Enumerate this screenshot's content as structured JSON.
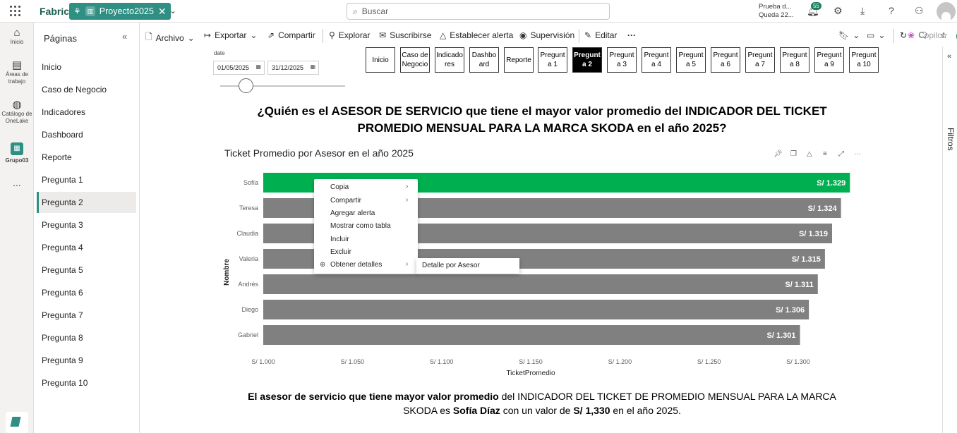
{
  "topbar": {
    "brand": "Fabric",
    "workspace": "Proyecto2025",
    "search_placeholder": "Buscar",
    "trial_line1": "Prueba d...",
    "trial_line2": "Queda 22...",
    "notification_count": "55",
    "icons": [
      "waffle-icon",
      "report-icon",
      "close-icon",
      "chevron-down-icon",
      "search-icon",
      "bell-icon",
      "gear-icon",
      "download-icon",
      "help-icon",
      "share-people-icon",
      "avatar"
    ]
  },
  "rail": {
    "items": [
      {
        "label": "Inicio",
        "icon": "home-icon"
      },
      {
        "label": "Áreas de trabajo",
        "icon": "workspaces-icon"
      },
      {
        "label": "Catálogo de OneLake",
        "icon": "onelake-icon"
      },
      {
        "label": "Grupo03",
        "icon": "group-icon"
      }
    ],
    "more": "..."
  },
  "pages": {
    "title": "Páginas",
    "items": [
      "Inicio",
      "Caso de Negocio",
      "Indicadores",
      "Dashboard",
      "Reporte",
      "Pregunta 1",
      "Pregunta 2",
      "Pregunta 3",
      "Pregunta 4",
      "Pregunta 5",
      "Pregunta 6",
      "Pregunta 7",
      "Pregunta 8",
      "Pregunta 9",
      "Pregunta 10"
    ],
    "active": "Pregunta 2"
  },
  "toolbar": {
    "archivo": "Archivo",
    "exportar": "Exportar",
    "compartir": "Compartir",
    "explorar": "Explorar",
    "suscribirse": "Suscribirse",
    "alerta": "Establecer alerta",
    "supervision": "Supervisión",
    "editar": "Editar",
    "more": "···",
    "copilot": "Copilot"
  },
  "filters": {
    "label": "Filtros"
  },
  "report": {
    "date_label": "date",
    "date_from": "01/05/2025",
    "date_to": "31/12/2025",
    "nav": [
      "Inicio",
      "Caso de Negocio",
      "Indicadores",
      "Dashboard",
      "Reporte",
      "Pregunta 1",
      "Pregunta 2",
      "Pregunta 3",
      "Pregunta 4",
      "Pregunta 5",
      "Pregunta 6",
      "Pregunta 7",
      "Pregunta 8",
      "Pregunta 9",
      "Pregunta 10"
    ],
    "nav_active": "Pregunta 2",
    "question": "¿Quién es el ASESOR DE SERVICIO que  tiene el mayor valor promedio del INDICADOR DEL TICKET PROMEDIO MENSUAL PARA LA MARCA SKODA  en el año 2025?",
    "answer_bold1": "El asesor de servicio que tiene mayor valor promedio",
    "answer_text1": " del INDICADOR DEL TICKET DE PROMEDIO MENSUAL PARA LA MARCA SKODA es ",
    "answer_bold2": "Sofía Díaz",
    "answer_text2": " con un valor de ",
    "answer_bold3": "S/ 1,330",
    "answer_text3": " en el año 2025."
  },
  "chart_data": {
    "type": "bar",
    "orientation": "horizontal",
    "title": "Ticket Promedio por Asesor en el año 2025",
    "xlabel": "TicketPromedio",
    "ylabel": "Nombre",
    "categories": [
      "Sofía",
      "Teresa",
      "Claudia",
      "Valeria",
      "Andrés",
      "Diego",
      "Gabriel"
    ],
    "values": [
      1329,
      1324,
      1319,
      1315,
      1311,
      1306,
      1301
    ],
    "data_labels": [
      "S/ 1.329",
      "S/ 1.324",
      "S/ 1.319",
      "S/ 1.315",
      "S/ 1.311",
      "S/ 1.306",
      "S/ 1.301"
    ],
    "xlim": [
      1000,
      1330
    ],
    "xticks": [
      1000,
      1050,
      1100,
      1150,
      1200,
      1250,
      1300
    ],
    "xtick_labels": [
      "S/ 1.000",
      "S/ 1.050",
      "S/ 1.100",
      "S/ 1.150",
      "S/ 1.200",
      "S/ 1.250",
      "S/ 1.300"
    ],
    "colors": {
      "highlight": "#00b050",
      "default": "#808080"
    },
    "highlight_index": 0
  },
  "context_menu": {
    "items": [
      "Copia",
      "Compartir",
      "Agregar alerta",
      "Mostrar como tabla",
      "Incluir",
      "Excluir",
      "Obtener detalles"
    ],
    "submenu_item": "Detalle por Asesor"
  }
}
